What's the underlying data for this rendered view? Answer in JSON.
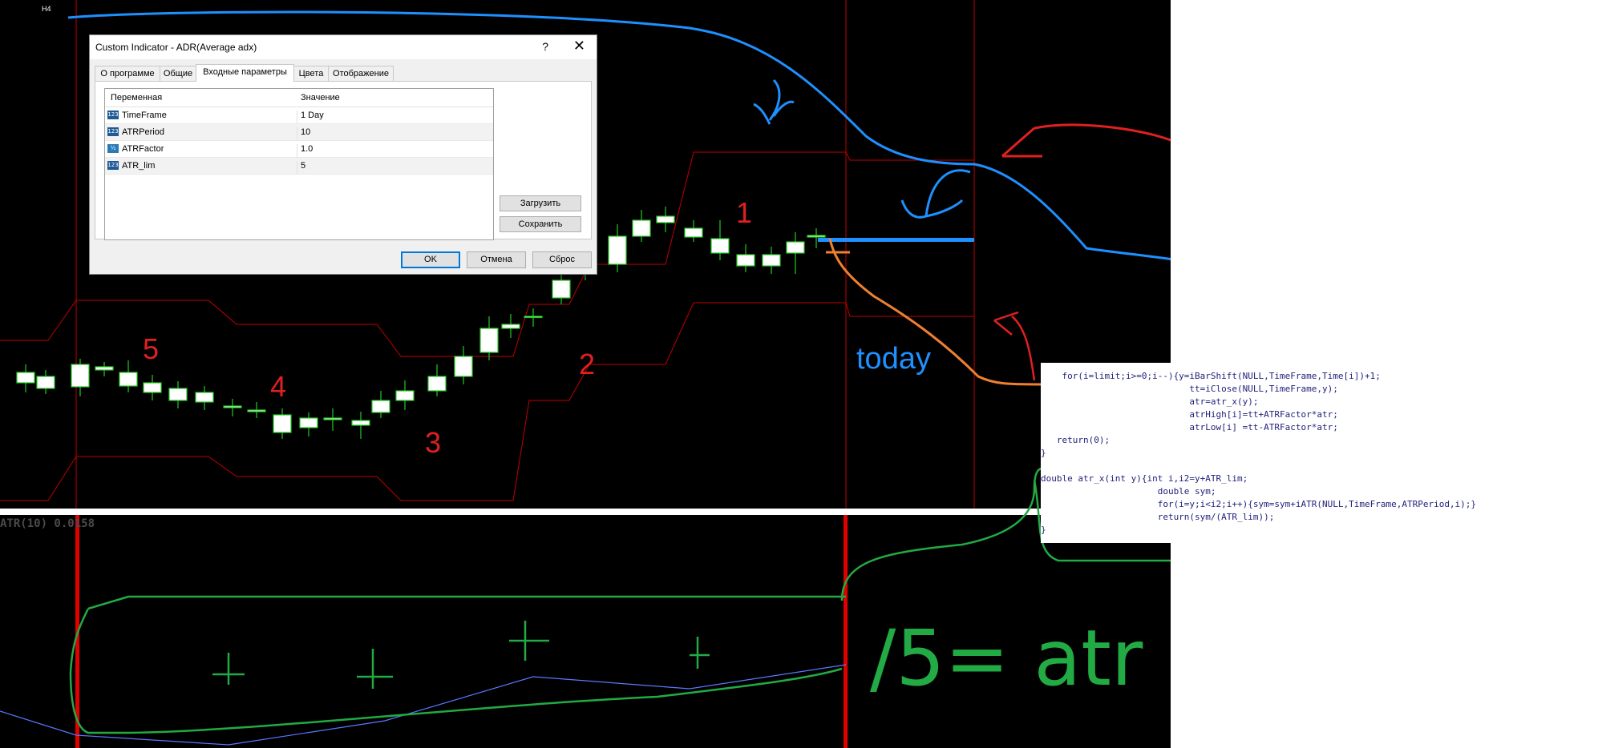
{
  "chart": {
    "timeframe_label": "H4",
    "indicator_readout": "ATR(10) 0.0158",
    "annotations": {
      "n1": "1",
      "n2": "2",
      "n3": "3",
      "n4": "4",
      "n5": "5",
      "today": "today",
      "formula": "/5= atr"
    },
    "colors": {
      "background": "#000000",
      "red_markup": "#e02020",
      "blue_markup": "#1e90ff",
      "green_markup": "#22aa44",
      "orange_markup": "#f08030",
      "candle_green": "#22cc22",
      "envelope_red": "#c00000",
      "atr_line": "#5a78ff"
    }
  },
  "dialog": {
    "title": "Custom Indicator - ADR(Average adx)",
    "help_icon": "?",
    "close_icon": "✕",
    "tabs": [
      "О программе",
      "Общие",
      "Входные параметры",
      "Цвета",
      "Отображение"
    ],
    "active_tab": "Входные параметры",
    "columns": [
      "Переменная",
      "Значение"
    ],
    "params": [
      {
        "icon": "123",
        "name": "TimeFrame",
        "value": "1 Day"
      },
      {
        "icon": "123",
        "name": "ATRPeriod",
        "value": "10"
      },
      {
        "icon": "½",
        "name": "ATRFactor",
        "value": "1.0"
      },
      {
        "icon": "123",
        "name": "ATR_lim",
        "value": "5"
      }
    ],
    "load_button": "Загрузить",
    "save_button": "Сохранить",
    "ok_button": "OK",
    "cancel_button": "Отмена",
    "reset_button": "Сброс"
  },
  "code": {
    "l1": "    for(i=limit;i>=0;i--){y=iBarShift(NULL,TimeFrame,Time[i])+1;",
    "l2": "                            tt=iClose(NULL,TimeFrame,y);",
    "l3": "                            atr=atr_x(y);",
    "l4": "                            atrHigh[i]=tt+ATRFactor*atr;",
    "l5": "                            atrLow[i] =tt-ATRFactor*atr;",
    "l6": "   return(0);",
    "l7": "}",
    "l8": "double atr_x(int y){int i,i2=y+ATR_lim;",
    "l9": "                      double sym;",
    "l10": "                      for(i=y;i<i2;i++){sym=sym+iATR(NULL,TimeFrame,ATRPeriod,i);}",
    "l11": "                      return(sym/(ATR_lim));",
    "l12": "}"
  }
}
